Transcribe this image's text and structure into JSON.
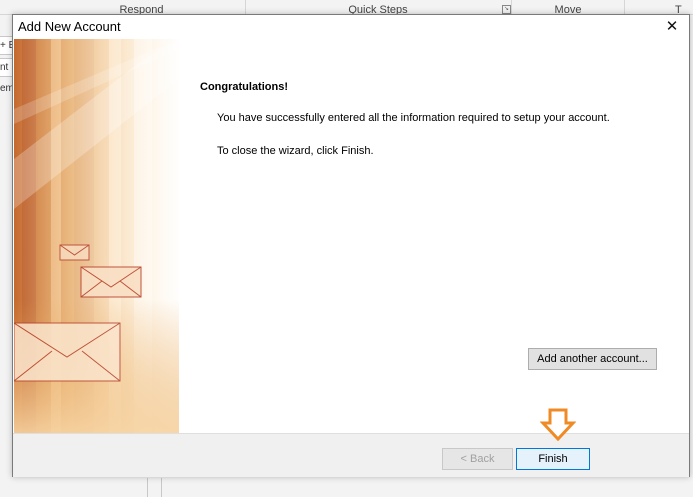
{
  "ribbon": {
    "groups": [
      "Respond",
      "Quick Steps",
      "Move",
      "T"
    ],
    "left_stubs": [
      "+ E",
      "nt",
      "em"
    ]
  },
  "dialog": {
    "title": "Add New Account",
    "close_label": "✕",
    "heading": "Congratulations!",
    "message_1": "You have successfully entered all the information required to setup your account.",
    "message_2": "To close the wizard, click Finish.",
    "add_account_label": "Add another account...",
    "back_label": "< Back",
    "finish_label": "Finish"
  },
  "colors": {
    "accent_orange": "#f08a24",
    "finish_border": "#0078d7",
    "art_gold": "#e9a24b",
    "art_brown": "#a8552a"
  }
}
